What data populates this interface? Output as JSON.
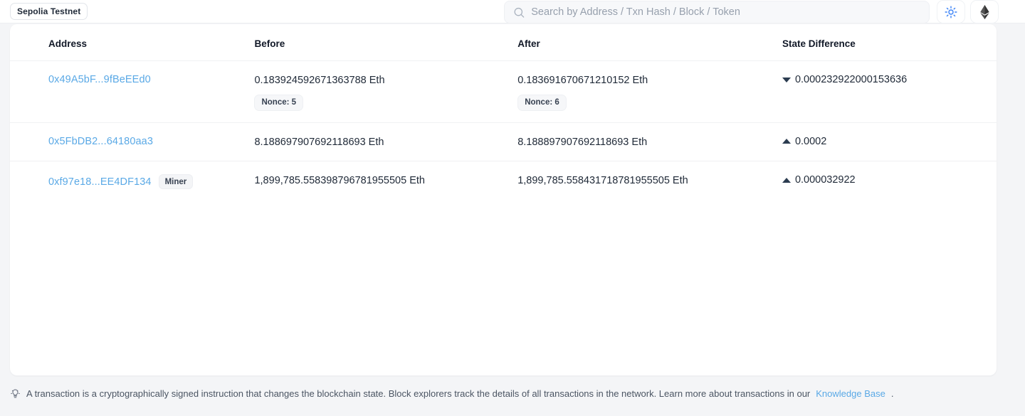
{
  "header": {
    "network_chip": "Sepolia Testnet",
    "search": {
      "placeholder": "Search by Address / Txn Hash / Block / Token",
      "value": "",
      "icon": "search-icon"
    },
    "theme_toggle_icon": "sun-icon",
    "chain_icon": "ethereum-icon"
  },
  "table": {
    "columns": [
      "Address",
      "Before",
      "After",
      "State Difference"
    ],
    "rows": [
      {
        "address": "0x49A5bF...9fBeEEd0",
        "tag": "",
        "before": "0.183924592671363788 Eth",
        "before_nonce": "Nonce: 5",
        "after": "0.183691670671210152 Eth",
        "after_nonce": "Nonce: 6",
        "diff_direction": "down",
        "diff_value": "0.000232922000153636"
      },
      {
        "address": "0x5FbDB2...64180aa3",
        "tag": "",
        "before": "8.188697907692118693 Eth",
        "before_nonce": "",
        "after": "8.188897907692118693 Eth",
        "after_nonce": "",
        "diff_direction": "up",
        "diff_value": "0.0002"
      },
      {
        "address": "0xf97e18...EE4DF134",
        "tag": "Miner",
        "before": "1,899,785.558398796781955505 Eth",
        "before_nonce": "",
        "after": "1,899,785.558431718781955505 Eth",
        "after_nonce": "",
        "diff_direction": "up",
        "diff_value": "0.000032922"
      }
    ]
  },
  "footer": {
    "icon": "lightbulb-icon",
    "text": "A transaction is a cryptographically signed instruction that changes the blockchain state. Block explorers track the details of all transactions in the network. Learn more about transactions in our ",
    "link_text": "Knowledge Base",
    "text_end": "."
  },
  "colors": {
    "link": "#5aa9e6",
    "accent": "#3b82f6",
    "page_bg": "#f4f5f7",
    "card_bg": "#ffffff",
    "text": "#1f2937",
    "triangle": "#2b3c50"
  }
}
